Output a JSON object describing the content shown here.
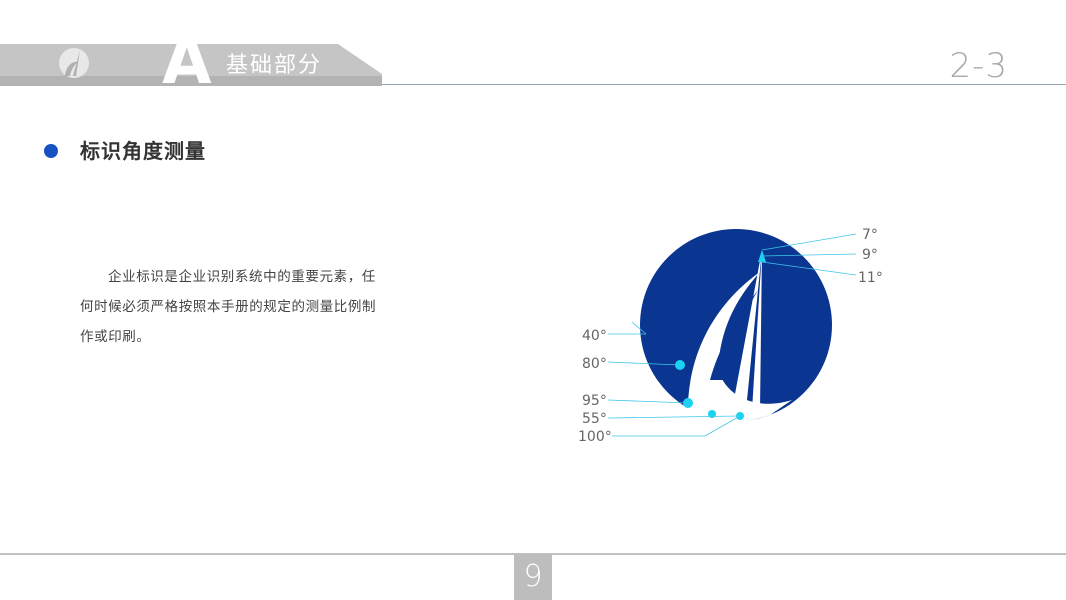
{
  "header": {
    "section_letter": "A",
    "section_title": "基础部分",
    "page_code": "2-3",
    "colors": {
      "band": "#c5c5c5",
      "band_dark": "#a6a6a6",
      "rule": "#9aa7b3"
    }
  },
  "content": {
    "heading": "标识角度测量",
    "body": "企业标识是企业识别系统中的重要元素，任何时候必须严格按照本手册的规定的测量比例制作或印刷。",
    "bullet_color": "#1652c4"
  },
  "diagram": {
    "logo_color": "#0a3591",
    "marker_color": "#19d3f0",
    "angle_labels_right": [
      "7°",
      "9°",
      "11°"
    ],
    "angle_labels_left": [
      "40°",
      "80°",
      "95°",
      "55°",
      "100°"
    ]
  },
  "footer": {
    "page_number": "9"
  }
}
